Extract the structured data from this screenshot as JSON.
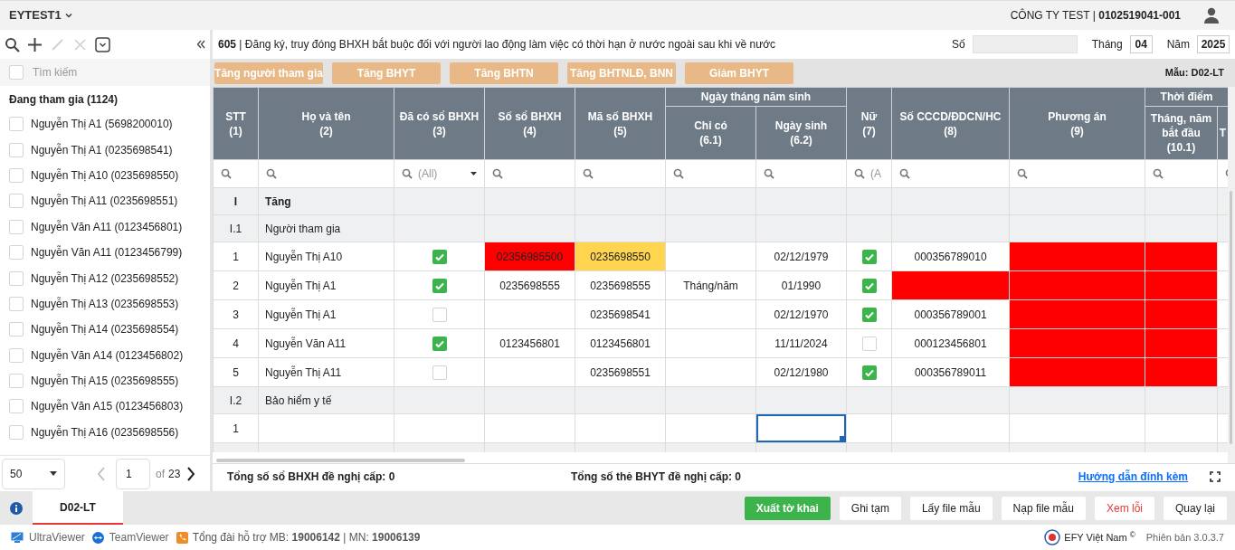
{
  "top_bar": {
    "workspace": "EYTEST1",
    "company": "CÔNG TY TEST | **0102519041-001**"
  },
  "sidebar": {
    "toolbar": [
      {
        "kind": "search",
        "disabled": false
      },
      {
        "kind": "add",
        "disabled": false
      },
      {
        "kind": "edit",
        "disabled": true
      },
      {
        "kind": "delete",
        "disabled": true
      },
      {
        "kind": "select",
        "disabled": false
      }
    ],
    "search_placeholder": "Tìm kiếm",
    "select_all_checked": false,
    "group_title": "Đang tham gia (1124)",
    "items": [
      {
        "label": "Nguyễn Thị A1 (5698200010)",
        "checked": false
      },
      {
        "label": "Nguyễn Thị A1 (0235698541)",
        "checked": false
      },
      {
        "label": "Nguyễn Thị A10 (0235698550)",
        "checked": false
      },
      {
        "label": "Nguyễn Thị A11 (0235698551)",
        "checked": false
      },
      {
        "label": "Nguyễn Văn A11 (0123456801)",
        "checked": false
      },
      {
        "label": "Nguyễn Văn A11 (0123456799)",
        "checked": false
      },
      {
        "label": "Nguyễn Thị A12 (0235698552)",
        "checked": false
      },
      {
        "label": "Nguyễn Thị A13 (0235698553)",
        "checked": false
      },
      {
        "label": "Nguyễn Thị A14 (0235698554)",
        "checked": false
      },
      {
        "label": "Nguyễn Văn A14 (0123456802)",
        "checked": false
      },
      {
        "label": "Nguyễn Thị A15 (0235698555)",
        "checked": false
      },
      {
        "label": "Nguyễn Văn A15 (0123456803)",
        "checked": false
      },
      {
        "label": "Nguyễn Thị A16 (0235698556)",
        "checked": false
      }
    ],
    "pager": {
      "page_size": "50",
      "page": "1",
      "of": "of",
      "total_pages": "23"
    }
  },
  "form": {
    "title": "**605** | Đăng ký, truy đóng BHXH bắt buộc đối với người lao động làm việc có thời hạn ở nước ngoài sau khi về nước",
    "number_label": "Số",
    "month_label": "Tháng",
    "month": "04",
    "year_label": "Năm",
    "year": "2025",
    "actions": [
      "Tăng người tham gia",
      "Tăng BHYT",
      "Tăng BHTN",
      "Tăng BHTNLĐ, BNN",
      "Giảm BHYT"
    ],
    "template": "Mẫu: D02-LT"
  },
  "table": {
    "header": [
      {
        "kind": "single",
        "label": "STT",
        "number": "(1)",
        "filter": {
          "kind": "search"
        }
      },
      {
        "kind": "single",
        "label": "Họ và tên",
        "number": "(2)",
        "filter": {
          "kind": "search"
        }
      },
      {
        "kind": "single",
        "label": "Đã có sổ BHXH",
        "number": "(3)",
        "filter": {
          "kind": "dropdown",
          "value": "(All)"
        }
      },
      {
        "kind": "single",
        "label": "Số sổ BHXH",
        "number": "(4)",
        "filter": {
          "kind": "search"
        }
      },
      {
        "kind": "single",
        "label": "Mã số BHXH",
        "number": "(5)",
        "filter": {
          "kind": "search"
        }
      },
      {
        "kind": "group",
        "label": "Ngày tháng năm sinh",
        "columns": [
          {
            "label": "Chỉ có",
            "number": "(6.1)",
            "filter": {
              "kind": "search"
            }
          },
          {
            "label": "Ngày sinh",
            "number": "(6.2)",
            "filter": {
              "kind": "search"
            }
          }
        ]
      },
      {
        "kind": "single",
        "label": "Nữ",
        "number": "(7)",
        "filter": {
          "kind": "dropdown",
          "value": "(A"
        }
      },
      {
        "kind": "single",
        "label": "Số CCCD/ĐDCN/HC",
        "number": "(8)",
        "filter": {
          "kind": "search"
        }
      },
      {
        "kind": "single",
        "label": "Phương án",
        "number": "(9)",
        "filter": {
          "kind": "search"
        }
      },
      {
        "kind": "group",
        "label": "Thời điểm",
        "columns": [
          {
            "label": "Tháng, năm bắt đầu",
            "number": "(10.1)",
            "filter": {
              "kind": "search"
            }
          },
          {
            "label": "T",
            "filter": {
              "kind": "search"
            }
          }
        ]
      }
    ],
    "rows": [
      {
        "kind": "section",
        "number": "I",
        "label": "Tăng"
      },
      {
        "kind": "subsection",
        "number": "I.1",
        "label": "Người tham gia"
      },
      {
        "kind": "data",
        "cells": [
          {
            "text": "1"
          },
          {
            "text": "Nguyễn Thị A10"
          },
          {
            "checked": true
          },
          {
            "text": "02356985500",
            "error": true
          },
          {
            "text": "0235698550",
            "warning": true
          },
          null,
          {
            "text": "02/12/1979"
          },
          {
            "checked": true
          },
          {
            "text": "000356789010"
          },
          {
            "error": true
          },
          {
            "error": true
          },
          null
        ]
      },
      {
        "kind": "data",
        "cells": [
          {
            "text": "2"
          },
          {
            "text": "Nguyễn Thị A1"
          },
          {
            "checked": true
          },
          {
            "text": "0235698555"
          },
          {
            "text": "0235698555"
          },
          {
            "text": "Tháng/năm"
          },
          {
            "text": "01/1990"
          },
          {
            "checked": true
          },
          {
            "error": true
          },
          {
            "error": true
          },
          {
            "error": true
          },
          null
        ]
      },
      {
        "kind": "data",
        "cells": [
          {
            "text": "3"
          },
          {
            "text": "Nguyễn Thị A1"
          },
          {
            "checked": false
          },
          null,
          {
            "text": "0235698541"
          },
          null,
          {
            "text": "02/12/1970"
          },
          {
            "checked": true
          },
          {
            "text": "000356789001"
          },
          {
            "error": true
          },
          {
            "error": true
          },
          null
        ]
      },
      {
        "kind": "data",
        "cells": [
          {
            "text": "4"
          },
          {
            "text": "Nguyễn Văn A11"
          },
          {
            "checked": true
          },
          {
            "text": "0123456801"
          },
          {
            "text": "0123456801"
          },
          null,
          {
            "text": "11/11/2024"
          },
          {
            "checked": false
          },
          {
            "text": "000123456801"
          },
          {
            "error": true
          },
          {
            "error": true
          },
          null
        ]
      },
      {
        "kind": "data",
        "cells": [
          {
            "text": "5"
          },
          {
            "text": "Nguyễn Thị A11"
          },
          {
            "checked": false
          },
          null,
          {
            "text": "0235698551"
          },
          null,
          {
            "text": "02/12/1980"
          },
          {
            "checked": true
          },
          {
            "text": "000356789011"
          },
          {
            "error": true
          },
          {
            "error": true
          },
          null
        ]
      },
      {
        "kind": "subsection",
        "number": "I.2",
        "label": "Bảo hiểm y tế"
      },
      {
        "kind": "data",
        "cells": [
          {
            "text": "1"
          },
          null,
          null,
          null,
          null,
          null,
          {
            "selected": true
          },
          null,
          null,
          null,
          null,
          null
        ]
      }
    ]
  },
  "summary": {
    "books": "Tổng số sổ BHXH đề nghị cấp: 0",
    "cards": "Tổng số thẻ BHYT đề nghị cấp: 0",
    "guide_link": "Hướng dẫn đính kèm"
  },
  "tabs": [
    {
      "label": "D02-LT",
      "selected": true
    }
  ],
  "buttons": [
    {
      "label": "Xuất tờ khai",
      "kind": "primary"
    },
    {
      "label": "Ghi tạm",
      "kind": "default"
    },
    {
      "label": "Lấy file mẫu",
      "kind": "default"
    },
    {
      "label": "Nạp file mẫu",
      "kind": "default"
    },
    {
      "label": "Xem lỗi",
      "kind": "danger"
    },
    {
      "label": "Quay lại",
      "kind": "default"
    }
  ],
  "footer": {
    "links": [
      {
        "kind": "ultraviewer",
        "label": "UltraViewer"
      },
      {
        "kind": "teamviewer",
        "label": "TeamViewer"
      }
    ],
    "hotline": "Tổng đài hỗ trợ MB: **19006142** | MN: **19006139**",
    "brand": "EFY Việt Nam $^{©}$",
    "version": "Phiên bản 3.0.3.7"
  }
}
